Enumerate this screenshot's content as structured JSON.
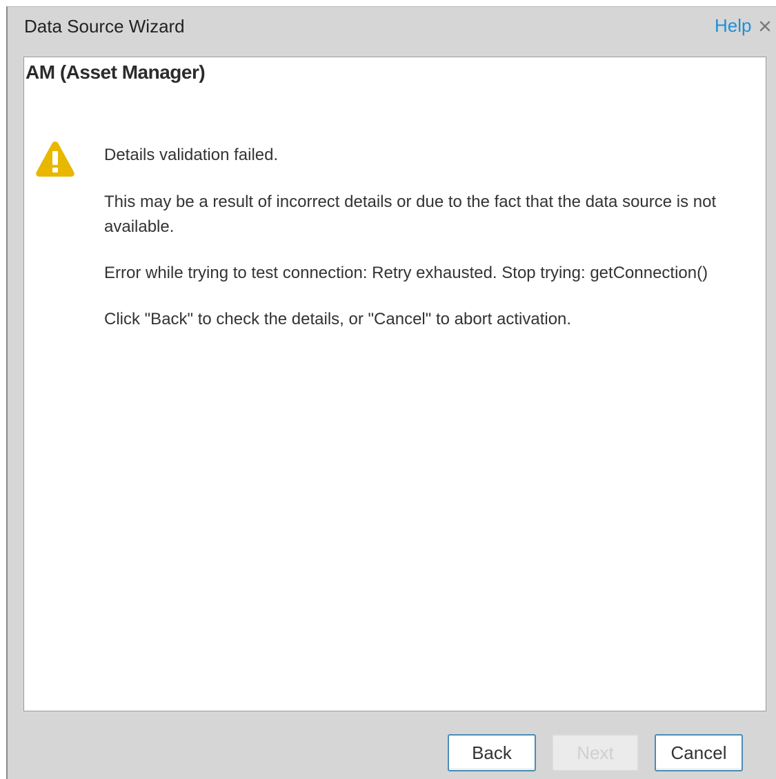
{
  "window": {
    "title": "Data Source Wizard",
    "help_label": "Help",
    "close_icon": "close-icon"
  },
  "panel": {
    "heading": "AM (Asset Manager)",
    "icon": "warning-icon",
    "messages": [
      "Details validation failed.",
      "This may be a result of incorrect details or due to the fact that the data source is not available.",
      "Error while trying to test connection: Retry exhausted. Stop trying: getConnection()",
      "Click \"Back\" to check the details, or \"Cancel\" to abort activation."
    ]
  },
  "footer": {
    "back_label": "Back",
    "next_label": "Next",
    "cancel_label": "Cancel",
    "next_disabled": true
  },
  "colors": {
    "help_link": "#1f8fd8",
    "warning": "#e8b800",
    "button_border": "#4a8bb5",
    "dialog_bg": "#d6d6d6"
  }
}
